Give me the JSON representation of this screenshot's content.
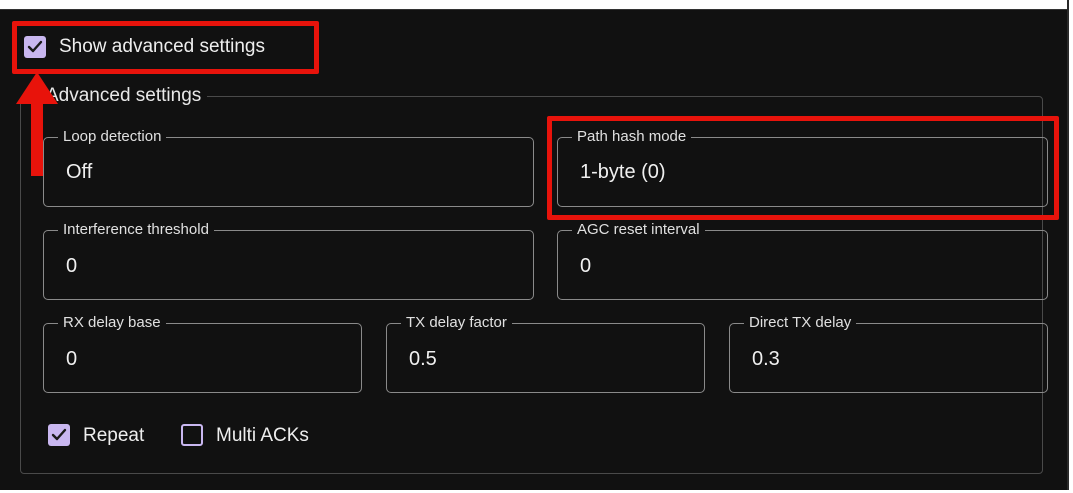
{
  "show_advanced": {
    "label": "Show advanced settings",
    "checked": true
  },
  "group": {
    "legend": "Advanced settings"
  },
  "fields": {
    "loop_detection": {
      "label": "Loop detection",
      "value": "Off"
    },
    "path_hash_mode": {
      "label": "Path hash mode",
      "value": "1-byte (0)"
    },
    "interference_threshold": {
      "label": "Interference threshold",
      "value": "0"
    },
    "agc_reset_interval": {
      "label": "AGC reset interval",
      "value": "0"
    },
    "rx_delay_base": {
      "label": "RX delay base",
      "value": "0"
    },
    "tx_delay_factor": {
      "label": "TX delay factor",
      "value": "0.5"
    },
    "direct_tx_delay": {
      "label": "Direct TX delay",
      "value": "0.3"
    }
  },
  "options": {
    "repeat": {
      "label": "Repeat",
      "checked": true
    },
    "multi_acks": {
      "label": "Multi ACKs",
      "checked": false
    }
  },
  "colors": {
    "accent": "#c9b7f0",
    "annotation": "#e8130b",
    "background": "#111111"
  }
}
